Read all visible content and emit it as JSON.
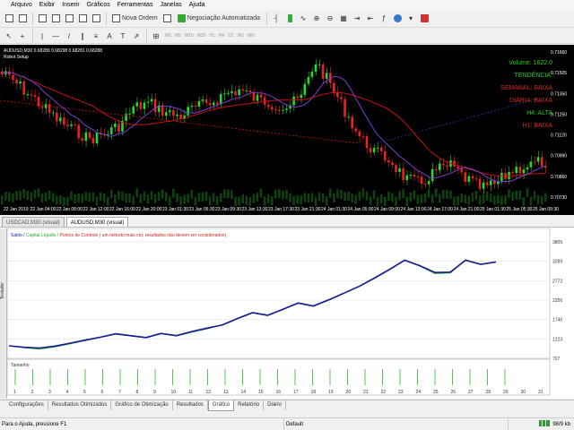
{
  "menu": [
    "Arquivo",
    "Exibir",
    "Inserir",
    "Gráficos",
    "Ferramentas",
    "Janelas",
    "Ajuda"
  ],
  "toolbar": {
    "new_order": "Nova Ordem",
    "auto_trading": "Negociação Automatizada",
    "timeframes": [
      "M1",
      "M5",
      "M15",
      "M30",
      "H1",
      "H4",
      "D1",
      "W1",
      "MN"
    ]
  },
  "chart": {
    "title": "AUDUSD,M30",
    "ohlc": "0.68289 0.68298 0.68281 0.68288",
    "ea_name": "Robot Setup",
    "indicators": [
      {
        "text": "Volume: 1622.0",
        "color": "#22cc22"
      },
      {
        "text": "TENDÊNCIA:",
        "color": "#22cc22"
      },
      {
        "text": "SEMANAL: BAIXA",
        "color": "#dd2222"
      },
      {
        "text": "DIÁRIA: BAIXA",
        "color": "#dd2222"
      },
      {
        "text": "H4: ALTA",
        "color": "#22cc22"
      },
      {
        "text": "H1: BAIXA",
        "color": "#dd2222"
      }
    ],
    "price_labels": [
      "0.71660",
      "0.71505",
      "0.71350",
      "0.71250",
      "0.71120",
      "0.70990",
      "0.70860",
      "0.70730"
    ],
    "time_labels": [
      "22 Jan 2019",
      "22 Jan 04:00",
      "22 Jan 08:00",
      "22 Jan 12:00",
      "22 Jan 16:00",
      "22 Jan 20:00",
      "23 Jan 01:30",
      "23 Jan 05:30",
      "23 Jan 09:30",
      "23 Jan 13:30",
      "23 Jan 17:30",
      "23 Jan 21:30",
      "24 Jan 01:30",
      "24 Jan 05:00",
      "24 Jan 09:00",
      "24 Jan 13:00",
      "24 Jan 17:00",
      "24 Jan 21:00",
      "25 Jan 01:30",
      "25 Jan 05:30",
      "25 Jan 09:30"
    ]
  },
  "chart_tabs": [
    "USDCAD,M30 (visual)",
    "AUDUSD,M30 (visual)"
  ],
  "tester": {
    "side_label": "Testador",
    "legend_saldo": "Saldo",
    "legend_capital": "Capital Líquido",
    "legend_pontos": "Pontos de Controle ( um método mais cru; resultados não devem ser considerados)",
    "y_labels": [
      "3805",
      "3289",
      "2772",
      "2256",
      "1740",
      "1223",
      "707"
    ],
    "size_label": "Tamanho",
    "x_labels": [
      "1",
      "2",
      "3",
      "4",
      "5",
      "6",
      "7",
      "8",
      "9",
      "10",
      "11",
      "12",
      "13",
      "14",
      "15",
      "16",
      "17",
      "18",
      "19",
      "20",
      "21",
      "22",
      "23",
      "24",
      "25",
      "26",
      "27",
      "28",
      "29",
      "30",
      "31"
    ]
  },
  "bottom_tabs": [
    "Configurações",
    "Resultados Otimizados",
    "Gráfico de Otimização",
    "Resultados",
    "Gráfico",
    "Relatório",
    "Diário"
  ],
  "bottom_active": 4,
  "status": {
    "help": "Para o Ajuda, pressione F1",
    "profile": "Default",
    "traffic": "98/9 kb"
  },
  "chart_data": {
    "type": "line",
    "x": [
      1,
      2,
      3,
      4,
      5,
      6,
      7,
      8,
      9,
      10,
      11,
      12,
      13,
      14,
      15,
      16,
      17,
      18,
      19,
      20,
      21,
      22,
      23,
      24,
      25,
      26,
      27,
      28,
      29
    ],
    "series": [
      {
        "name": "Saldo",
        "values": [
          1040,
          1000,
          980,
          1030,
          1110,
          1190,
          1270,
          1360,
          1310,
          1260,
          1370,
          1310,
          1420,
          1510,
          1590,
          1760,
          1920,
          1850,
          2010,
          2180,
          2100,
          2260,
          2440,
          2620,
          2840,
          3070,
          3320,
          3170,
          2990,
          3000,
          3320,
          3210,
          3270
        ]
      },
      {
        "name": "Capital Líquido",
        "values": [
          1040,
          990,
          950,
          1010,
          1090,
          1180,
          1260,
          1350,
          1300,
          1250,
          1360,
          1300,
          1400,
          1490,
          1600,
          1770,
          1930,
          1860,
          2000,
          2170,
          2090,
          2250,
          2430,
          2610,
          2830,
          3060,
          3310,
          3160,
          2960,
          2980,
          3310,
          3200,
          3270
        ]
      }
    ],
    "ylim": [
      707,
      3805
    ],
    "bars": [
      1,
      1,
      1,
      1,
      1,
      1,
      1,
      1,
      1,
      1,
      1,
      1,
      1,
      1,
      1,
      1,
      1,
      1,
      1,
      1,
      1,
      1,
      1,
      1,
      1,
      1,
      1,
      1,
      1
    ]
  }
}
